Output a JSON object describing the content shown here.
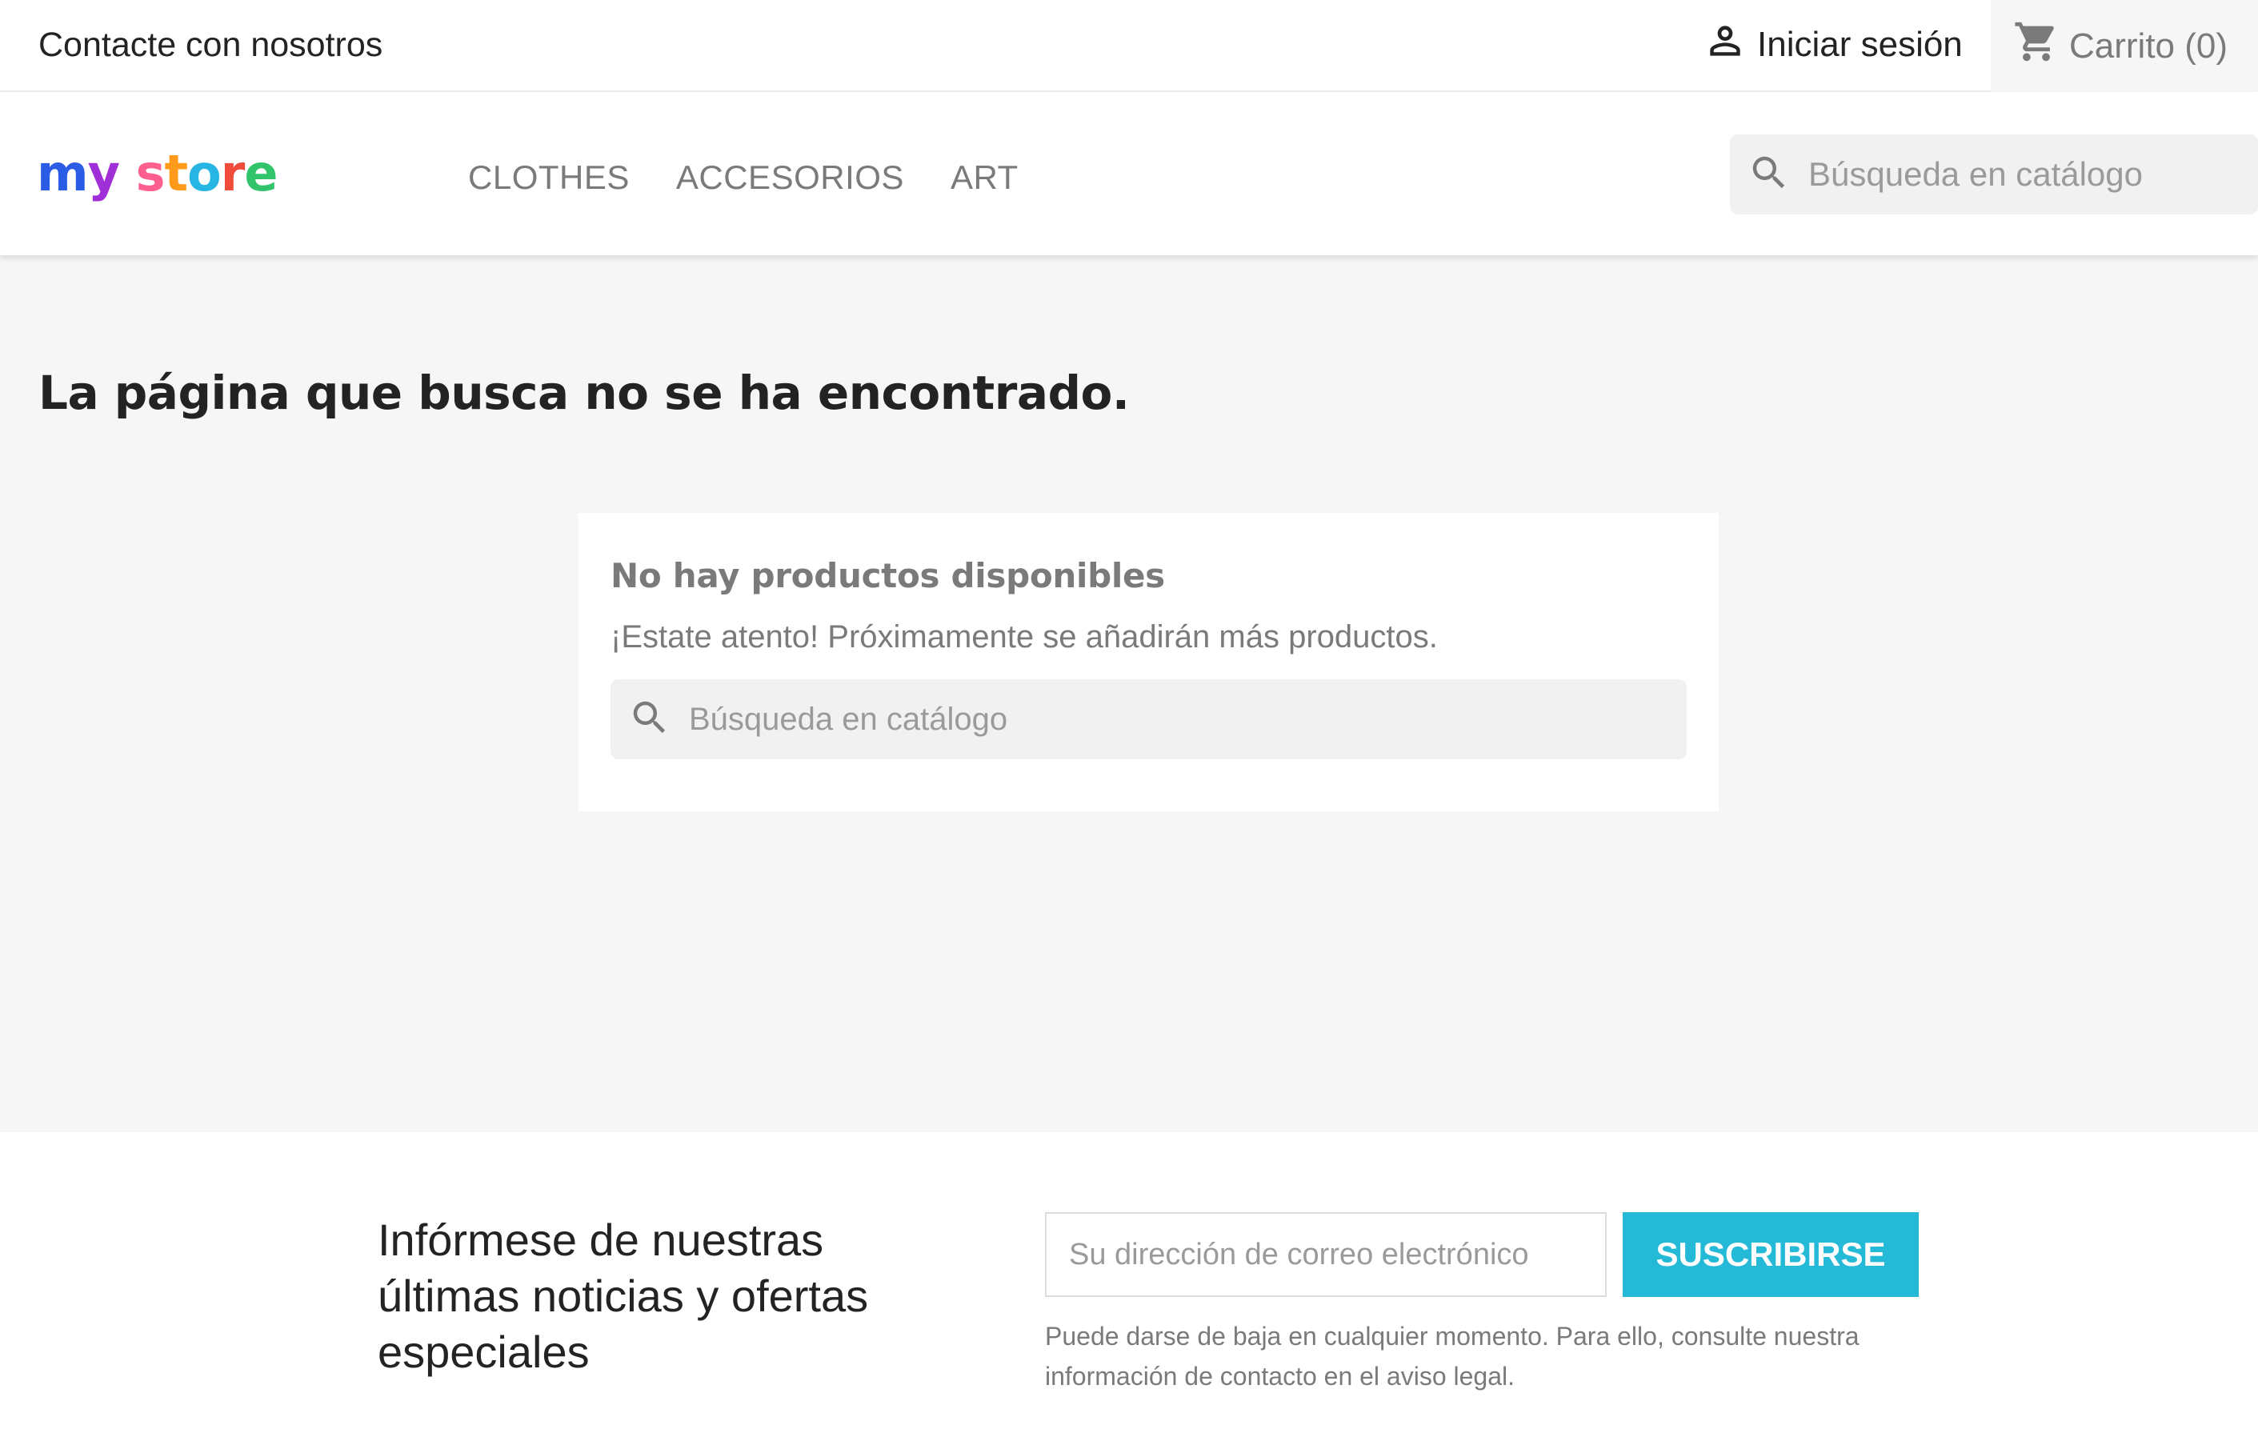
{
  "topbar": {
    "contact_label": "Contacte con nosotros",
    "signin_label": "Iniciar sesión",
    "signin_icon": "user-icon",
    "cart_label": "Carrito (0)",
    "cart_icon": "shopping-cart-icon"
  },
  "header": {
    "logo_text": "my store",
    "nav": [
      "CLOTHES",
      "ACCESORIOS",
      "ART"
    ],
    "search_placeholder": "Búsqueda en catálogo",
    "search_icon": "search-icon"
  },
  "main": {
    "title": "La página que busca no se ha encontrado.",
    "card": {
      "heading": "No hay productos disponibles",
      "text": "¡Estate atento! Próximamente se añadirán más productos.",
      "search_placeholder": "Búsqueda en catálogo"
    }
  },
  "newsletter": {
    "title": "Infórmese de nuestras últimas noticias y ofertas especiales",
    "email_placeholder": "Su dirección de correo electrónico",
    "button_label": "SUSCRIBIRSE",
    "note": "Puede darse de baja en cualquier momento. Para ello, consulte nuestra información de contacto en el aviso legal."
  },
  "colors": {
    "accent": "#24b9d7",
    "text_dark": "#232323",
    "text_muted": "#7a7a7a",
    "page_bg": "#f6f6f6"
  }
}
